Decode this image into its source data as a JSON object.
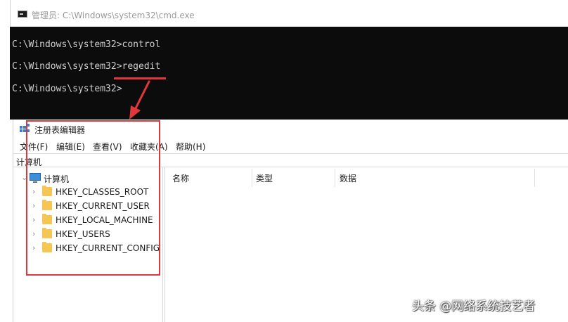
{
  "cmd": {
    "title": "管理员: C:\\Windows\\system32\\cmd.exe",
    "lines": [
      "C:\\Windows\\system32>control",
      "C:\\Windows\\system32>regedit",
      "C:\\Windows\\system32>"
    ]
  },
  "regedit": {
    "title": "注册表编辑器",
    "menu": [
      "文件(F)",
      "编辑(E)",
      "查看(V)",
      "收藏夹(A)",
      "帮助(H)"
    ],
    "address": "计算机",
    "tree": {
      "root": "计算机",
      "keys": [
        "HKEY_CLASSES_ROOT",
        "HKEY_CURRENT_USER",
        "HKEY_LOCAL_MACHINE",
        "HKEY_USERS",
        "HKEY_CURRENT_CONFIG"
      ]
    },
    "columns": [
      "名称",
      "类型",
      "数据"
    ]
  },
  "watermark": "头条 @网络系统技艺者",
  "colors": {
    "annotation_red": "#e0383a",
    "console_bg": "#0c0c0c",
    "folder_yellow": "#f6c655"
  }
}
